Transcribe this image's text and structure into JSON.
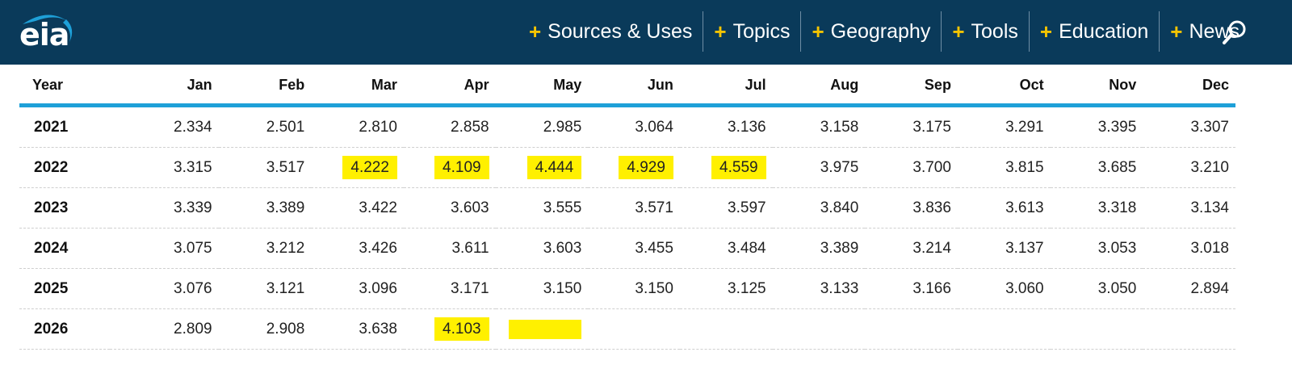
{
  "header": {
    "logo_text": "eia",
    "nav": [
      {
        "label": "Sources & Uses"
      },
      {
        "label": "Topics"
      },
      {
        "label": "Geography"
      },
      {
        "label": "Tools"
      },
      {
        "label": "Education"
      },
      {
        "label": "News"
      }
    ],
    "plus_glyph": "+",
    "search_icon": "search-icon",
    "colors": {
      "header_bg": "#0a3a5a",
      "plus": "#f5c400",
      "rule": "#1ea0d8",
      "highlight": "#fff000"
    }
  },
  "table": {
    "columns": [
      "Year",
      "Jan",
      "Feb",
      "Mar",
      "Apr",
      "May",
      "Jun",
      "Jul",
      "Aug",
      "Sep",
      "Oct",
      "Nov",
      "Dec"
    ],
    "rows": [
      {
        "year": "2021",
        "values": [
          "2.334",
          "2.501",
          "2.810",
          "2.858",
          "2.985",
          "3.064",
          "3.136",
          "3.158",
          "3.175",
          "3.291",
          "3.395",
          "3.307"
        ],
        "highlighted": []
      },
      {
        "year": "2022",
        "values": [
          "3.315",
          "3.517",
          "4.222",
          "4.109",
          "4.444",
          "4.929",
          "4.559",
          "3.975",
          "3.700",
          "3.815",
          "3.685",
          "3.210"
        ],
        "highlighted": [
          2,
          3,
          4,
          5,
          6
        ]
      },
      {
        "year": "2023",
        "values": [
          "3.339",
          "3.389",
          "3.422",
          "3.603",
          "3.555",
          "3.571",
          "3.597",
          "3.840",
          "3.836",
          "3.613",
          "3.318",
          "3.134"
        ],
        "highlighted": []
      },
      {
        "year": "2024",
        "values": [
          "3.075",
          "3.212",
          "3.426",
          "3.611",
          "3.603",
          "3.455",
          "3.484",
          "3.389",
          "3.214",
          "3.137",
          "3.053",
          "3.018"
        ],
        "highlighted": []
      },
      {
        "year": "2025",
        "values": [
          "3.076",
          "3.121",
          "3.096",
          "3.171",
          "3.150",
          "3.150",
          "3.125",
          "3.133",
          "3.166",
          "3.060",
          "3.050",
          "2.894"
        ],
        "highlighted": []
      },
      {
        "year": "2026",
        "values": [
          "2.809",
          "2.908",
          "3.638",
          "4.103",
          "",
          "",
          "",
          "",
          "",
          "",
          "",
          ""
        ],
        "highlighted": [
          3,
          4
        ]
      }
    ]
  }
}
